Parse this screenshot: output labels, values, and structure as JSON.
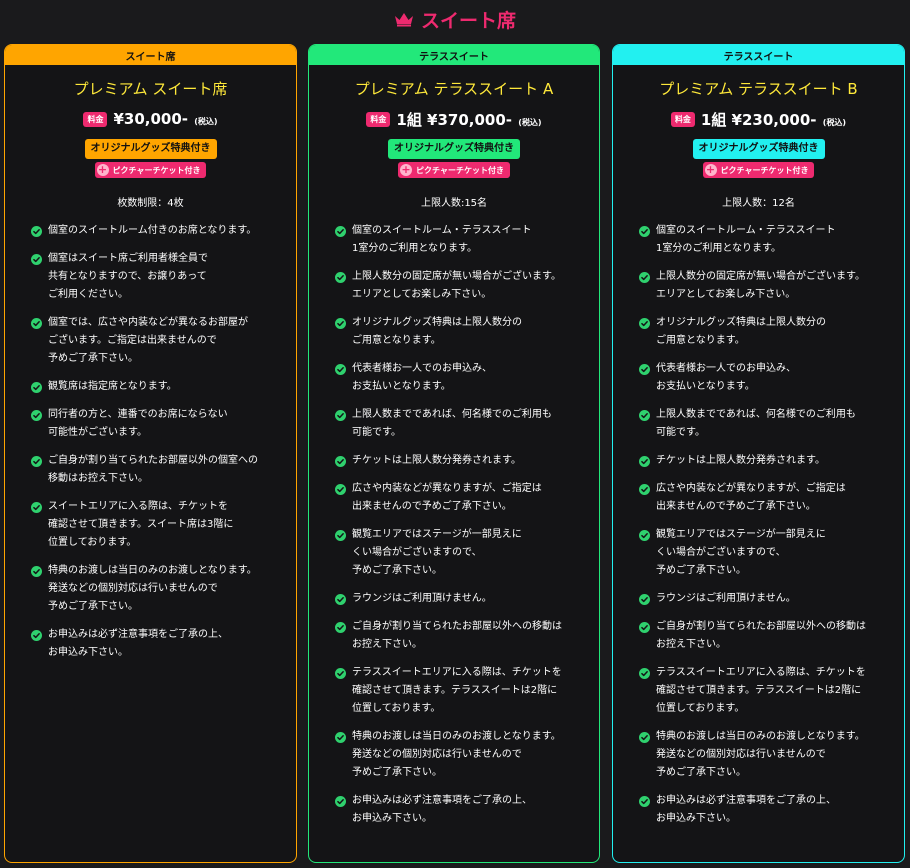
{
  "page": {
    "title": "スイート席",
    "icon": "crown-icon"
  },
  "colors": {
    "accent_pink": "#ee2a6f",
    "plan_yellow": "#ffe93a",
    "check_green": "#2fd16e",
    "background": "#1a1a1c"
  },
  "cards": [
    {
      "header": "スイート席",
      "color": "#ffa500",
      "plan_name": "プレミアム スイート席",
      "price_badge": "料金",
      "price": "¥30,000-",
      "tax_note": "(税込)",
      "goods_tag": "オリジナルグッズ特典付き",
      "picture_ticket": "ピクチャーチケット付き",
      "limit": "枚数制限：4枚",
      "notes": [
        "個室のスイートルーム付きのお席となります。",
        "個室はスイート席ご利用者様全員で\n共有となりますので、お譲りあって\nご利用ください。",
        "個室では、広さや内装などが異なるお部屋が\nございます。ご指定は出来ませんので\n予めご了承下さい。",
        "観覧席は指定席となります。",
        "同行者の方と、連番でのお席にならない\n可能性がございます。",
        "ご自身が割り当てられたお部屋以外の個室への\n移動はお控え下さい。",
        "スイートエリアに入る際は、チケットを\n確認させて頂きます。スイート席は3階に\n位置しております。",
        "特典のお渡しは当日のみのお渡しとなります。\n発送などの個別対応は行いませんので\n予めご了承下さい。",
        "お申込みは必ず注意事項をご了承の上、\nお申込み下さい。"
      ]
    },
    {
      "header": "テラススイート",
      "color": "#22e87a",
      "plan_name": "プレミアム テラススイート A",
      "price_badge": "料金",
      "price": "1組 ¥370,000-",
      "tax_note": "(税込)",
      "goods_tag": "オリジナルグッズ特典付き",
      "picture_ticket": "ピクチャーチケット付き",
      "limit": "上限人数:15名",
      "notes": [
        "個室のスイートルーム・テラススイート\n1室分のご利用となります。",
        "上限人数分の固定席が無い場合がございます。\nエリアとしてお楽しみ下さい。",
        "オリジナルグッズ特典は上限人数分の\nご用意となります。",
        "代表者様お一人でのお申込み、\nお支払いとなります。",
        "上限人数までであれば、何名様でのご利用も\n可能です。",
        "チケットは上限人数分発券されます。",
        "広さや内装などが異なりますが、ご指定は\n出来ませんので予めご了承下さい。",
        "観覧エリアではステージが一部見えに\nくい場合がございますので、\n予めご了承下さい。",
        "ラウンジはご利用頂けません。",
        "ご自身が割り当てられたお部屋以外への移動は\nお控え下さい。",
        "テラススイートエリアに入る際は、チケットを\n確認させて頂きます。テラススイートは2階に\n位置しております。",
        "特典のお渡しは当日のみのお渡しとなります。\n発送などの個別対応は行いませんので\n予めご了承下さい。",
        "お申込みは必ず注意事項をご了承の上、\nお申込み下さい。"
      ]
    },
    {
      "header": "テラススイート",
      "color": "#22f0f0",
      "plan_name": "プレミアム テラススイート B",
      "price_badge": "料金",
      "price": "1組 ¥230,000-",
      "tax_note": "(税込)",
      "goods_tag": "オリジナルグッズ特典付き",
      "picture_ticket": "ピクチャーチケット付き",
      "limit": "上限人数：12名",
      "notes": [
        "個室のスイートルーム・テラススイート\n1室分のご利用となります。",
        "上限人数分の固定席が無い場合がございます。\nエリアとしてお楽しみ下さい。",
        "オリジナルグッズ特典は上限人数分の\nご用意となります。",
        "代表者様お一人でのお申込み、\nお支払いとなります。",
        "上限人数までであれば、何名様でのご利用も\n可能です。",
        "チケットは上限人数分発券されます。",
        "広さや内装などが異なりますが、ご指定は\n出来ませんので予めご了承下さい。",
        "観覧エリアではステージが一部見えに\nくい場合がございますので、\n予めご了承下さい。",
        "ラウンジはご利用頂けません。",
        "ご自身が割り当てられたお部屋以外への移動は\nお控え下さい。",
        "テラススイートエリアに入る際は、チケットを\n確認させて頂きます。テラススイートは2階に\n位置しております。",
        "特典のお渡しは当日のみのお渡しとなります。\n発送などの個別対応は行いませんので\n予めご了承下さい。",
        "お申込みは必ず注意事項をご了承の上、\nお申込み下さい。"
      ]
    }
  ]
}
